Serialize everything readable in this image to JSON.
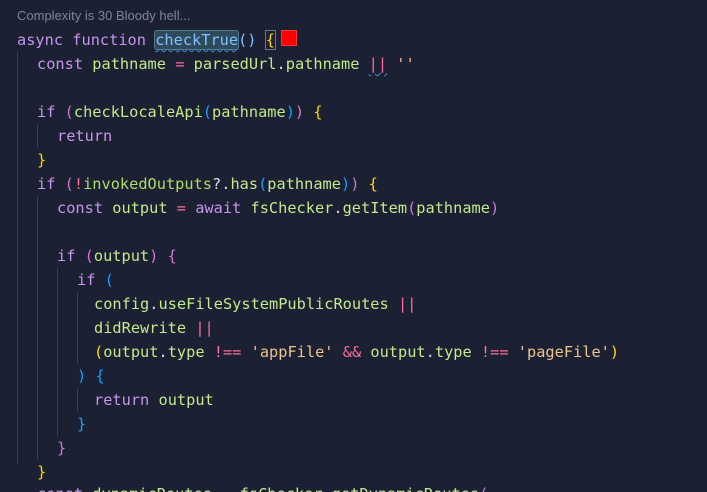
{
  "codelens": "Complexity is 30 Bloody hell...",
  "swatch_color": "#ff0000",
  "colors": {
    "background": "#1b2132",
    "keyword": "#c594ec",
    "function": "#7fc1ff",
    "operator": "#ff6b9a",
    "string": "#ecc48d"
  },
  "code": {
    "l1": {
      "async": "async",
      "function": "function",
      "name": "checkTrue",
      "parens": "()",
      "brace": "{"
    },
    "l2": {
      "const": "const",
      "var": "pathname",
      "eq": "=",
      "obj": "parsedUrl",
      "dot": ".",
      "prop": "pathname",
      "or": "||",
      "str": "''"
    },
    "l4": {
      "if": "if",
      "po": "(",
      "fn": "checkLocaleApi",
      "pi": "(",
      "arg": "pathname",
      "pc": ")",
      "pc2": ")",
      "brace": "{"
    },
    "l5": {
      "ret": "return"
    },
    "l6": {
      "brace": "}"
    },
    "l7": {
      "if": "if",
      "po": "(",
      "not": "!",
      "obj": "invokedOutputs",
      "opt": "?.",
      "fn": "has",
      "pi": "(",
      "arg": "pathname",
      "pc": ")",
      "pc2": ")",
      "brace": "{"
    },
    "l8": {
      "const": "const",
      "var": "output",
      "eq": "=",
      "await": "await",
      "obj": "fsChecker",
      "dot": ".",
      "fn": "getItem",
      "pi": "(",
      "arg": "pathname",
      "pc": ")"
    },
    "l10": {
      "if": "if",
      "po": "(",
      "arg": "output",
      "pc": ")",
      "brace": "{"
    },
    "l11": {
      "if": "if",
      "po": "("
    },
    "l12": {
      "obj": "config",
      "dot": ".",
      "prop": "useFileSystemPublicRoutes",
      "or": "||"
    },
    "l13": {
      "var": "didRewrite",
      "or": "||"
    },
    "l14": {
      "po": "(",
      "o1": "output",
      "d1": ".",
      "t1": "type",
      "ne1": "!==",
      "s1": "'appFile'",
      "and": "&&",
      "o2": "output",
      "d2": ".",
      "t2": "type",
      "ne2": "!==",
      "s2": "'pageFile'",
      "pc": ")"
    },
    "l15": {
      "pc": ")",
      "brace": "{"
    },
    "l16": {
      "ret": "return",
      "var": "output"
    },
    "l17": {
      "brace": "}"
    },
    "l18": {
      "brace": "}"
    },
    "l19": {
      "brace": "}"
    },
    "l20": {
      "const": "const",
      "var": "dynamicRoutes",
      "eq": "=",
      "obj": "fsChecker",
      "dot": ".",
      "fn": "getDynamicRoutes",
      "pi": "("
    }
  }
}
